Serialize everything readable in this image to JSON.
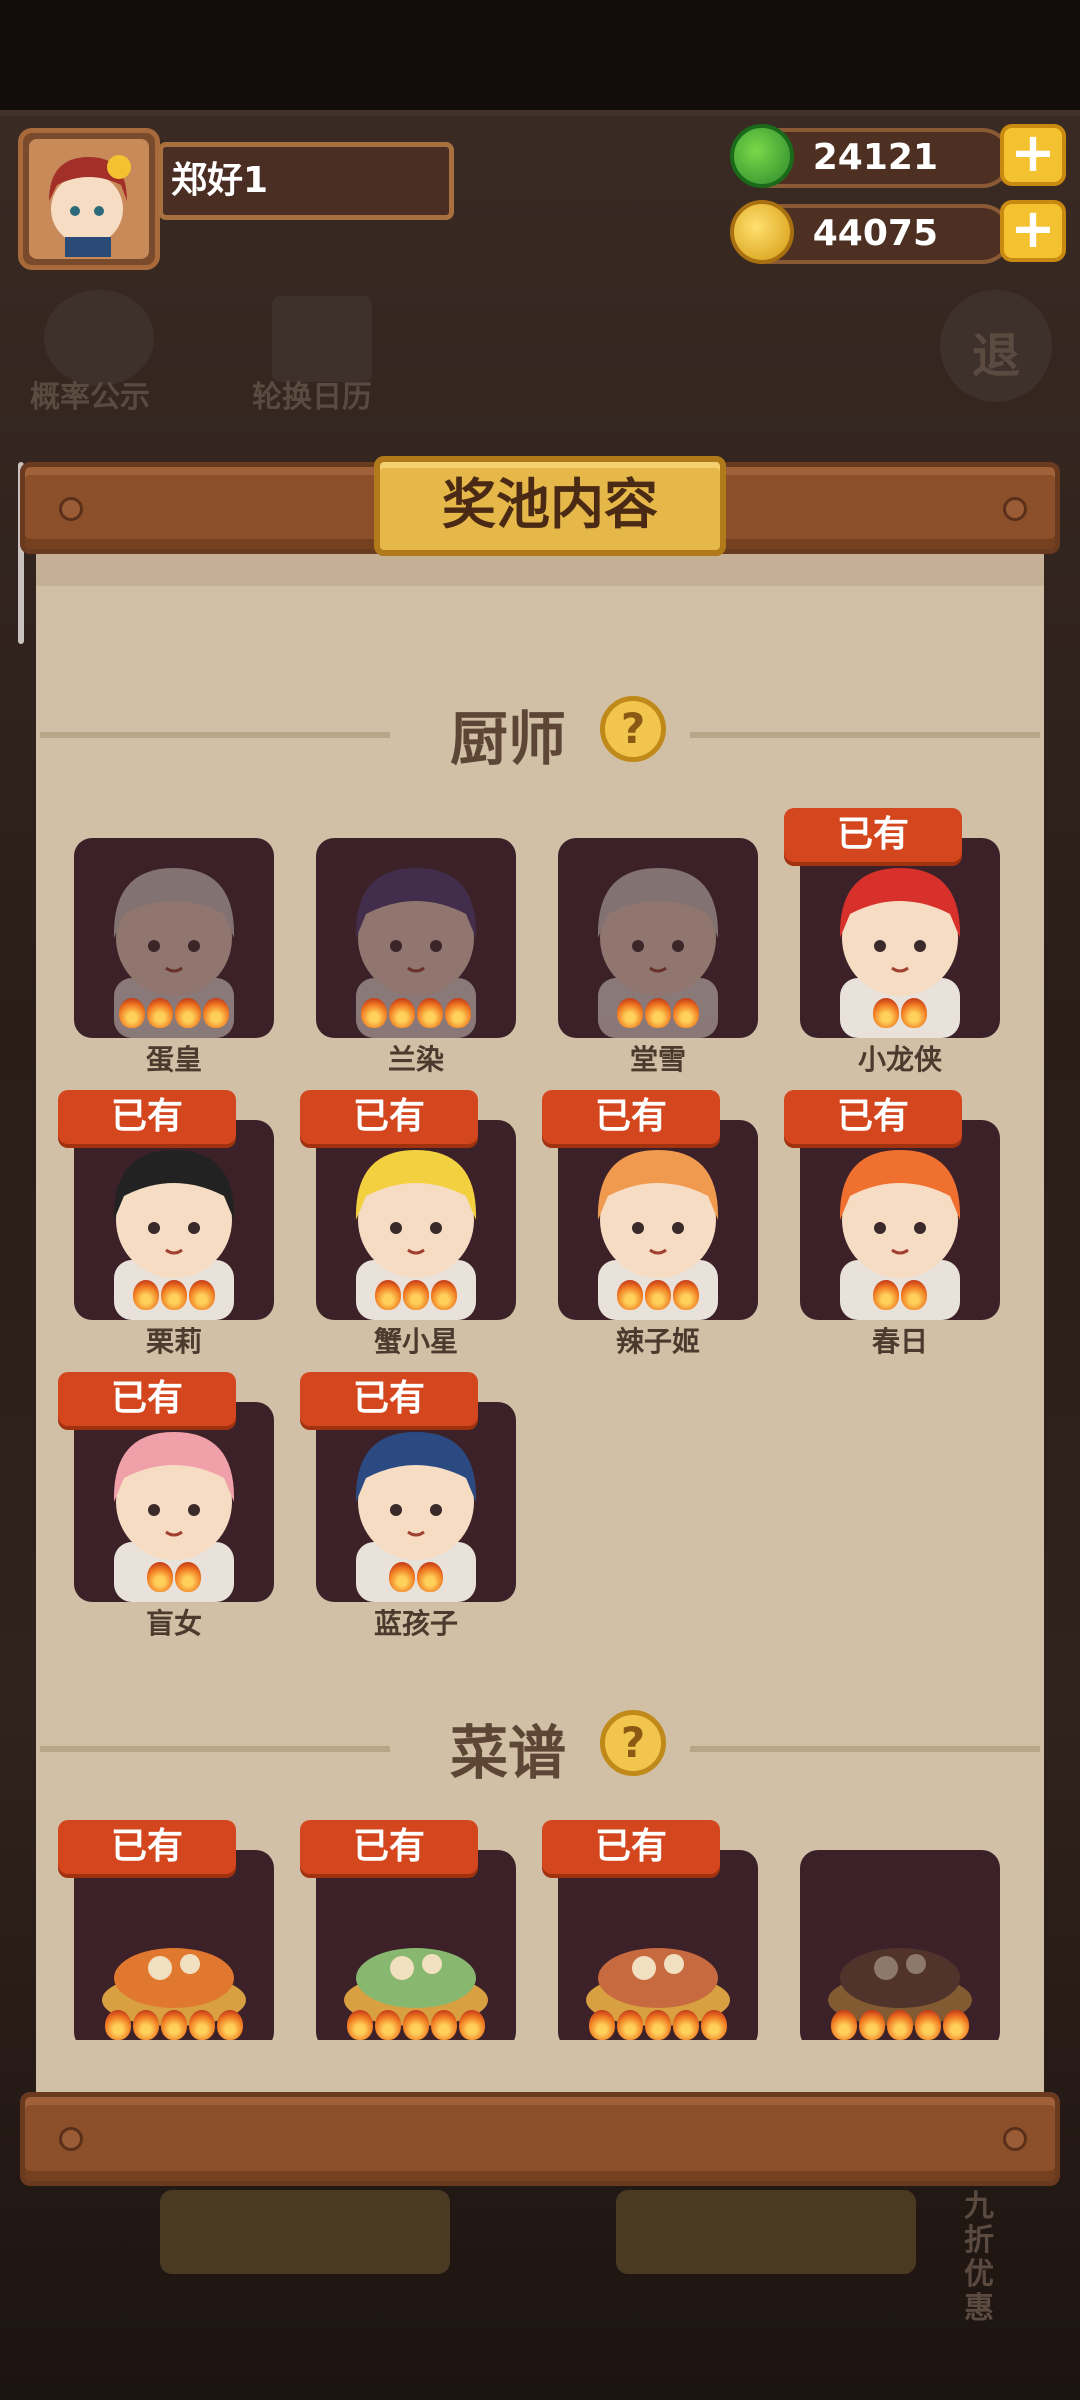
{
  "player": {
    "name": "郑好1"
  },
  "resources": {
    "jade": "24121",
    "coins": "44075"
  },
  "bg_menu": {
    "probability_label": "概率公示",
    "calendar_label": "轮换日历",
    "exit_label": "退",
    "discount_label": "九折优惠"
  },
  "panel": {
    "title": "奖池内容"
  },
  "sections": {
    "chefs": {
      "title": "厨师",
      "help": "?"
    },
    "recipes": {
      "title": "菜谱",
      "help": "?"
    }
  },
  "owned_label": "已有",
  "chefs": [
    {
      "name": "蛋皇",
      "owned": false,
      "stars": 4
    },
    {
      "name": "兰染",
      "owned": false,
      "stars": 4
    },
    {
      "name": "堂雪",
      "owned": false,
      "stars": 3
    },
    {
      "name": "小龙侠",
      "owned": true,
      "stars": 2
    },
    {
      "name": "栗莉",
      "owned": true,
      "stars": 3
    },
    {
      "name": "蟹小星",
      "owned": true,
      "stars": 3
    },
    {
      "name": "辣子姬",
      "owned": true,
      "stars": 3
    },
    {
      "name": "春日",
      "owned": true,
      "stars": 2
    },
    {
      "name": "盲女",
      "owned": true,
      "stars": 2
    },
    {
      "name": "蓝孩子",
      "owned": true,
      "stars": 2
    }
  ],
  "recipes": [
    {
      "owned": true,
      "stars": 5
    },
    {
      "owned": true,
      "stars": 5
    },
    {
      "owned": true,
      "stars": 5
    },
    {
      "owned": false,
      "stars": 5
    }
  ],
  "colors": {
    "owned_badge": "#d4461e",
    "card_bg": "#3c2228",
    "paper": "#d2c0a6",
    "gold_plate": "#e6b84a"
  }
}
